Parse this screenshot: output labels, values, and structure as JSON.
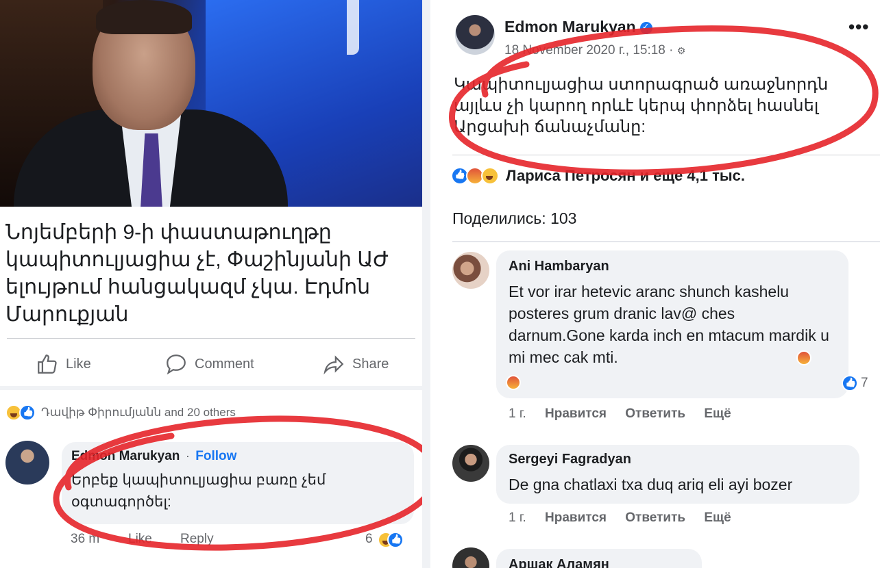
{
  "left_post": {
    "headline": "Նոյեմբերի 9-ի փաստաթուղթը կապիտուլյացիա չէ, Փաշինյանի ԱԺ ելույթում հանցակազմ չկա. Էդմոն Մարուքյան",
    "actions": {
      "like": "Like",
      "comment": "Comment",
      "share": "Share"
    },
    "reactions_text": "Դավիթ Փիրումյանն and 20 others",
    "comment": {
      "author": "Edmon Marukyan",
      "separator": "·",
      "follow": "Follow",
      "text": "Երբեք կապիտուլյացիա բառը չեմ օգտագործել:",
      "time": "36 m",
      "like": "Like",
      "reply": "Reply",
      "reaction_count": "6"
    }
  },
  "right_post": {
    "author": "Edmon Marukyan",
    "date": "18 November 2020 г., 15:18 ·",
    "post_text": "Կապիտուլյացիա ստորագրած առաջնորդն այլևս չի կարող որևէ կերպ փորձել հասնել Արցախի ճանաչմանը:",
    "reactions_text": "Лариса Петросян и еще 4,1 тыс.",
    "shares": "Поделились: 103",
    "comments": [
      {
        "author": "Ani Hambaryan",
        "text": "Et vor irar hetevic aranc shunch kashelu posteres grum dranic lav@ ches darnum.Gone karda inch en mtacum mardik u mi mec cak mti.",
        "time": "1 г.",
        "like": "Нравится",
        "reply": "Ответить",
        "more": "Ещё",
        "reaction_count": "7"
      },
      {
        "author": "Sergeyi Fagradyan",
        "text": "De gna chatlaxi txa duq ariq eli ayi bozer",
        "time": "1 г.",
        "like": "Нравится",
        "reply": "Ответить",
        "more": "Ещё"
      },
      {
        "author": "Аршак Аламян"
      }
    ]
  },
  "colors": {
    "facebook_blue": "#1877f2",
    "red_marker": "#e5252a",
    "comment_bubble": "#f0f2f5"
  }
}
